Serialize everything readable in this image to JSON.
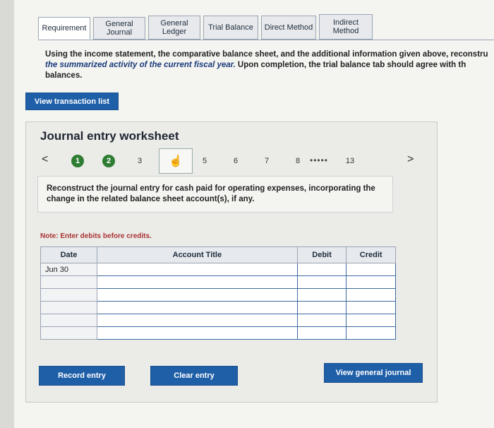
{
  "tabs": [
    {
      "label": "Requirement"
    },
    {
      "label": "General Journal"
    },
    {
      "label": "General Ledger"
    },
    {
      "label": "Trial Balance"
    },
    {
      "label": "Direct Method"
    },
    {
      "label": "Indirect Method"
    }
  ],
  "instructions": {
    "part1": "Using the income statement, the comparative balance sheet, and the additional information given above, reconstru",
    "part2": "the summarized activity of the current fiscal year.",
    "part3": " Upon completion, the trial balance tab should agree with th",
    "part4": "balances."
  },
  "buttons": {
    "view_transaction_list": "View transaction list",
    "record_entry": "Record entry",
    "clear_entry": "Clear entry",
    "view_general_journal": "View general journal"
  },
  "worksheet": {
    "title": "Journal entry worksheet",
    "nav_prev": "<",
    "nav_next": ">",
    "steps": [
      "1",
      "2",
      "3",
      "5",
      "6",
      "7",
      "8",
      "13"
    ],
    "ellipsis": "•••••",
    "prompt": "Reconstruct the journal entry for cash paid for operating expenses, incorporating the change in the related balance sheet account(s), if any.",
    "note": "Note: Enter debits before credits.",
    "table": {
      "headers": {
        "date": "Date",
        "account": "Account Title",
        "debit": "Debit",
        "credit": "Credit"
      },
      "first_date": "Jun 30"
    }
  }
}
